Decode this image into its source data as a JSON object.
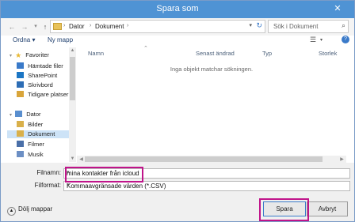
{
  "window": {
    "title": "Spara som",
    "close_glyph": "✕"
  },
  "nav": {
    "back_glyph": "←",
    "forward_glyph": "→",
    "up_glyph": "↑",
    "path": [
      "Dator",
      "Dokument"
    ],
    "search_placeholder": "Sök i Dokument"
  },
  "toolbar": {
    "organize_label": "Ordna ▾",
    "new_folder_label": "Ny mapp",
    "help_glyph": "?"
  },
  "sidebar": {
    "items": [
      {
        "label": "Favoriter",
        "icon": "star-icon",
        "color": "#e8b830"
      },
      {
        "label": "Hämtade filer",
        "icon": "download-icon",
        "color": "#3a7ac9"
      },
      {
        "label": "SharePoint",
        "icon": "sharepoint-icon",
        "color": "#1b76c4"
      },
      {
        "label": "Skrivbord",
        "icon": "desktop-icon",
        "color": "#2d6db5"
      },
      {
        "label": "Tidigare platser",
        "icon": "recent-places-icon",
        "color": "#d9a53a"
      },
      {
        "label": "Dator",
        "icon": "computer-icon",
        "color": "#5a8fcf"
      },
      {
        "label": "Bilder",
        "icon": "pictures-icon",
        "color": "#d9b04a"
      },
      {
        "label": "Dokument",
        "icon": "documents-icon",
        "color": "#d9b04a"
      },
      {
        "label": "Filmer",
        "icon": "videos-icon",
        "color": "#4a6fa8"
      },
      {
        "label": "Musik",
        "icon": "music-icon",
        "color": "#6c8fc4"
      }
    ]
  },
  "columns": [
    "Namn",
    "Senast ändrad",
    "Typ",
    "Storlek"
  ],
  "empty_message": "Inga objekt matchar sökningen.",
  "fields": {
    "filename_label": "Filnamn:",
    "filename_value": "mina kontakter från icloud",
    "format_label": "Filformat:",
    "format_value": "Kommaavgränsade värden (*.CSV)"
  },
  "footer": {
    "hide_folders_label": "Dölj mappar",
    "save_label": "Spara",
    "cancel_label": "Avbryt"
  },
  "colors": {
    "titlebar": "#4f93d4",
    "highlight": "#c0148a"
  }
}
